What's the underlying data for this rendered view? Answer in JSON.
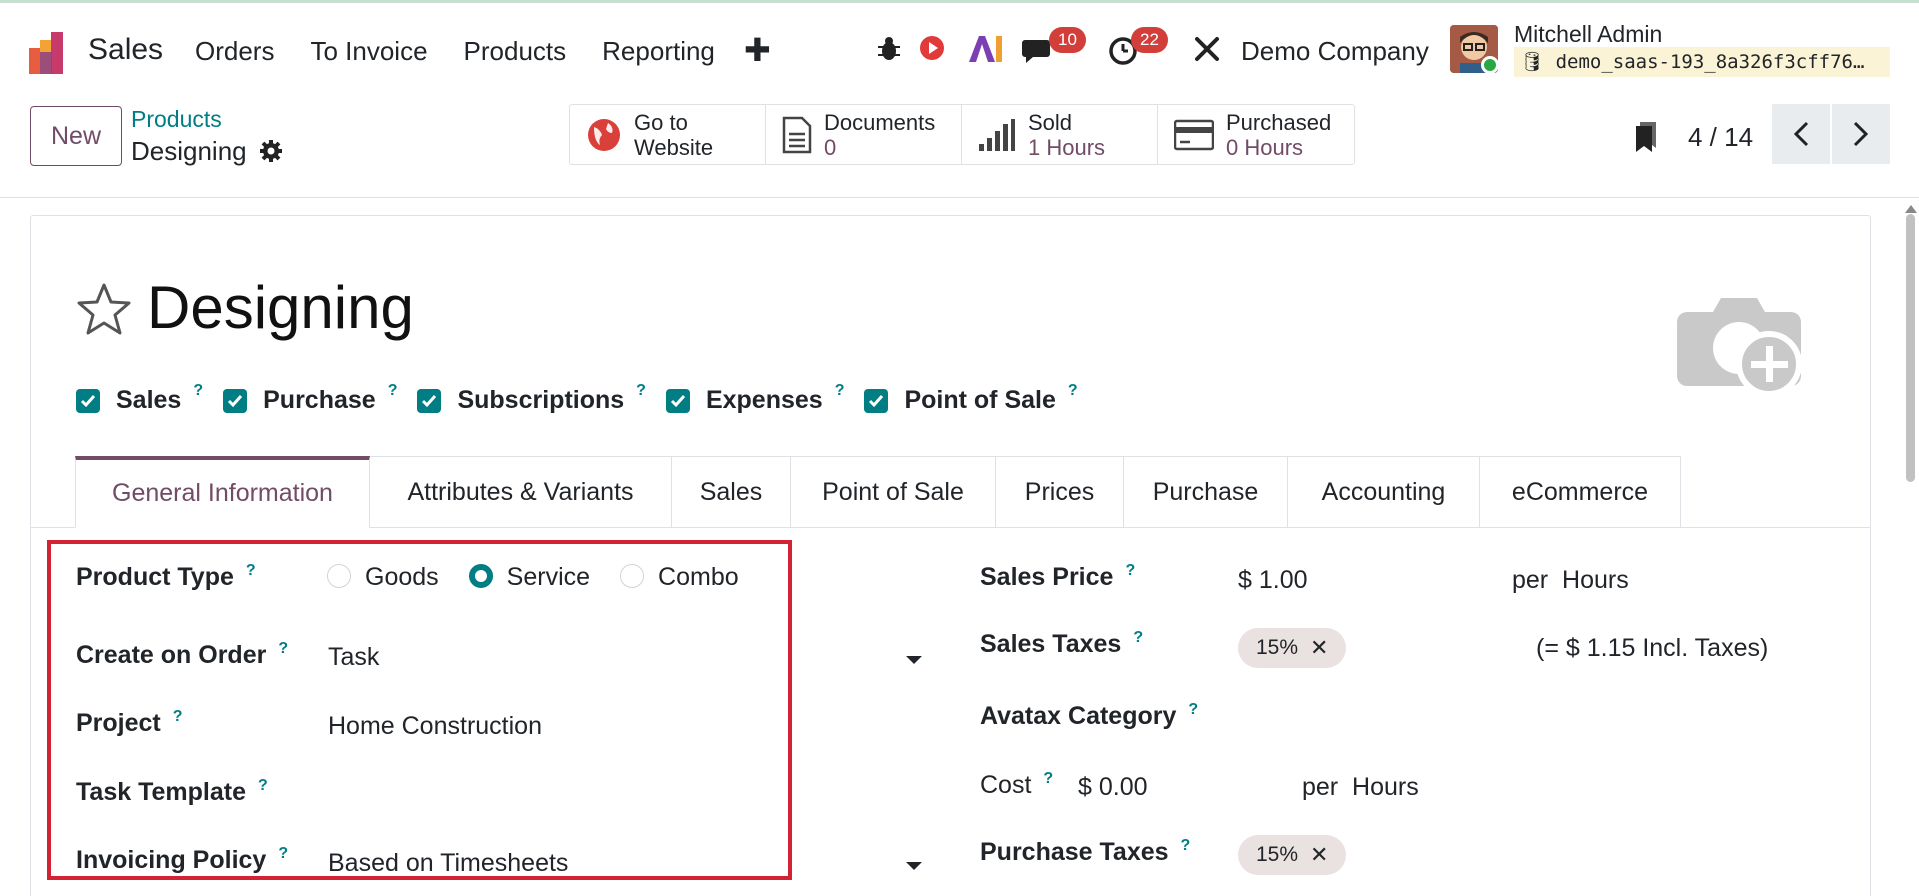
{
  "topnav": {
    "app_name": "Sales",
    "menu": [
      "Orders",
      "To Invoice",
      "Products",
      "Reporting"
    ],
    "chat_badge": "10",
    "activity_badge": "22",
    "company": "Demo Company",
    "user_name": "Mitchell Admin",
    "db_name": "demo_saas-193_8a326f3cff76…"
  },
  "control_panel": {
    "new_label": "New",
    "breadcrumb_parent": "Products",
    "breadcrumb_current": "Designing",
    "smart_buttons": [
      {
        "line1": "Go to",
        "line2": "Website"
      },
      {
        "line1": "Documents",
        "line2": "0"
      },
      {
        "line1": "Sold",
        "line2": "1 Hours"
      },
      {
        "line1": "Purchased",
        "line2": "0 Hours"
      }
    ],
    "pager": "4 / 14"
  },
  "form": {
    "title": "Designing",
    "checkboxes": [
      "Sales",
      "Purchase",
      "Subscriptions",
      "Expenses",
      "Point of Sale"
    ],
    "help_mark": "?",
    "tabs": [
      "General Information",
      "Attributes & Variants",
      "Sales",
      "Point of Sale",
      "Prices",
      "Purchase",
      "Accounting",
      "eCommerce"
    ],
    "left": {
      "product_type_label": "Product Type",
      "product_type_options": [
        "Goods",
        "Service",
        "Combo"
      ],
      "create_on_order_label": "Create on Order",
      "create_on_order_value": "Task",
      "project_label": "Project",
      "project_value": "Home Construction",
      "task_template_label": "Task Template",
      "invoicing_policy_label": "Invoicing Policy",
      "invoicing_policy_value": "Based on Timesheets"
    },
    "right": {
      "sales_price_label": "Sales Price",
      "sales_price_value": "$ 1.00",
      "per_label": "per",
      "uom": "Hours",
      "sales_taxes_label": "Sales Taxes",
      "sales_tax_tag": "15%",
      "incl_taxes": "(= $ 1.15 Incl. Taxes)",
      "avatax_label": "Avatax Category",
      "cost_label": "Cost",
      "cost_value": "$ 0.00",
      "purchase_taxes_label": "Purchase Taxes",
      "purchase_tax_tag": "15%"
    }
  },
  "colors": {
    "brand": "#714b67",
    "teal": "#017e84",
    "highlight_box": "#d32233"
  }
}
